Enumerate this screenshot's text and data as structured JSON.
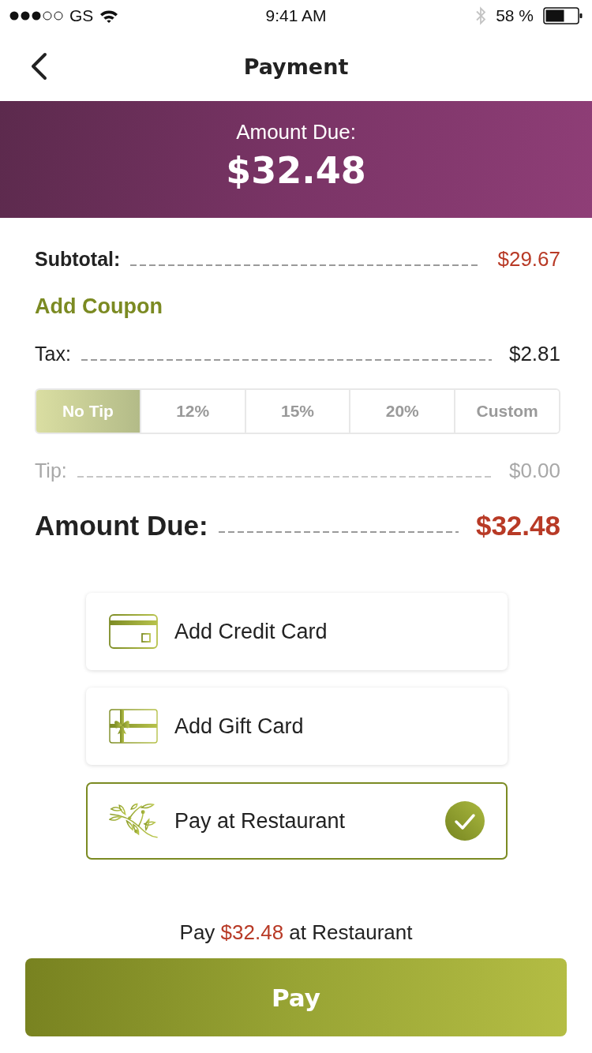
{
  "status_bar": {
    "carrier": "GS",
    "time": "9:41 AM",
    "battery": "58 %"
  },
  "nav": {
    "title": "Payment"
  },
  "header": {
    "label": "Amount Due:",
    "amount": "$32.48"
  },
  "summary": {
    "subtotal": {
      "label": "Subtotal:",
      "value": "$29.67"
    },
    "coupon_link": "Add Coupon",
    "tax": {
      "label": "Tax:",
      "value": "$2.81"
    },
    "tip_options": [
      {
        "label": "No Tip",
        "selected": true
      },
      {
        "label": "12%",
        "selected": false
      },
      {
        "label": "15%",
        "selected": false
      },
      {
        "label": "20%",
        "selected": false
      },
      {
        "label": "Custom",
        "selected": false
      }
    ],
    "tip": {
      "label": "Tip:",
      "value": "$0.00",
      "disabled": true
    },
    "total": {
      "label": "Amount Due:",
      "value": "$32.48"
    }
  },
  "payment_methods": [
    {
      "kind": "credit_card",
      "label": "Add Credit Card",
      "selected": false
    },
    {
      "kind": "gift_card",
      "label": "Add Gift Card",
      "selected": false
    },
    {
      "kind": "restaurant",
      "label": "Pay at Restaurant",
      "selected": true
    }
  ],
  "pay_note": "Pay **$32.48** at Restaurant",
  "pay_button": "Pay"
}
